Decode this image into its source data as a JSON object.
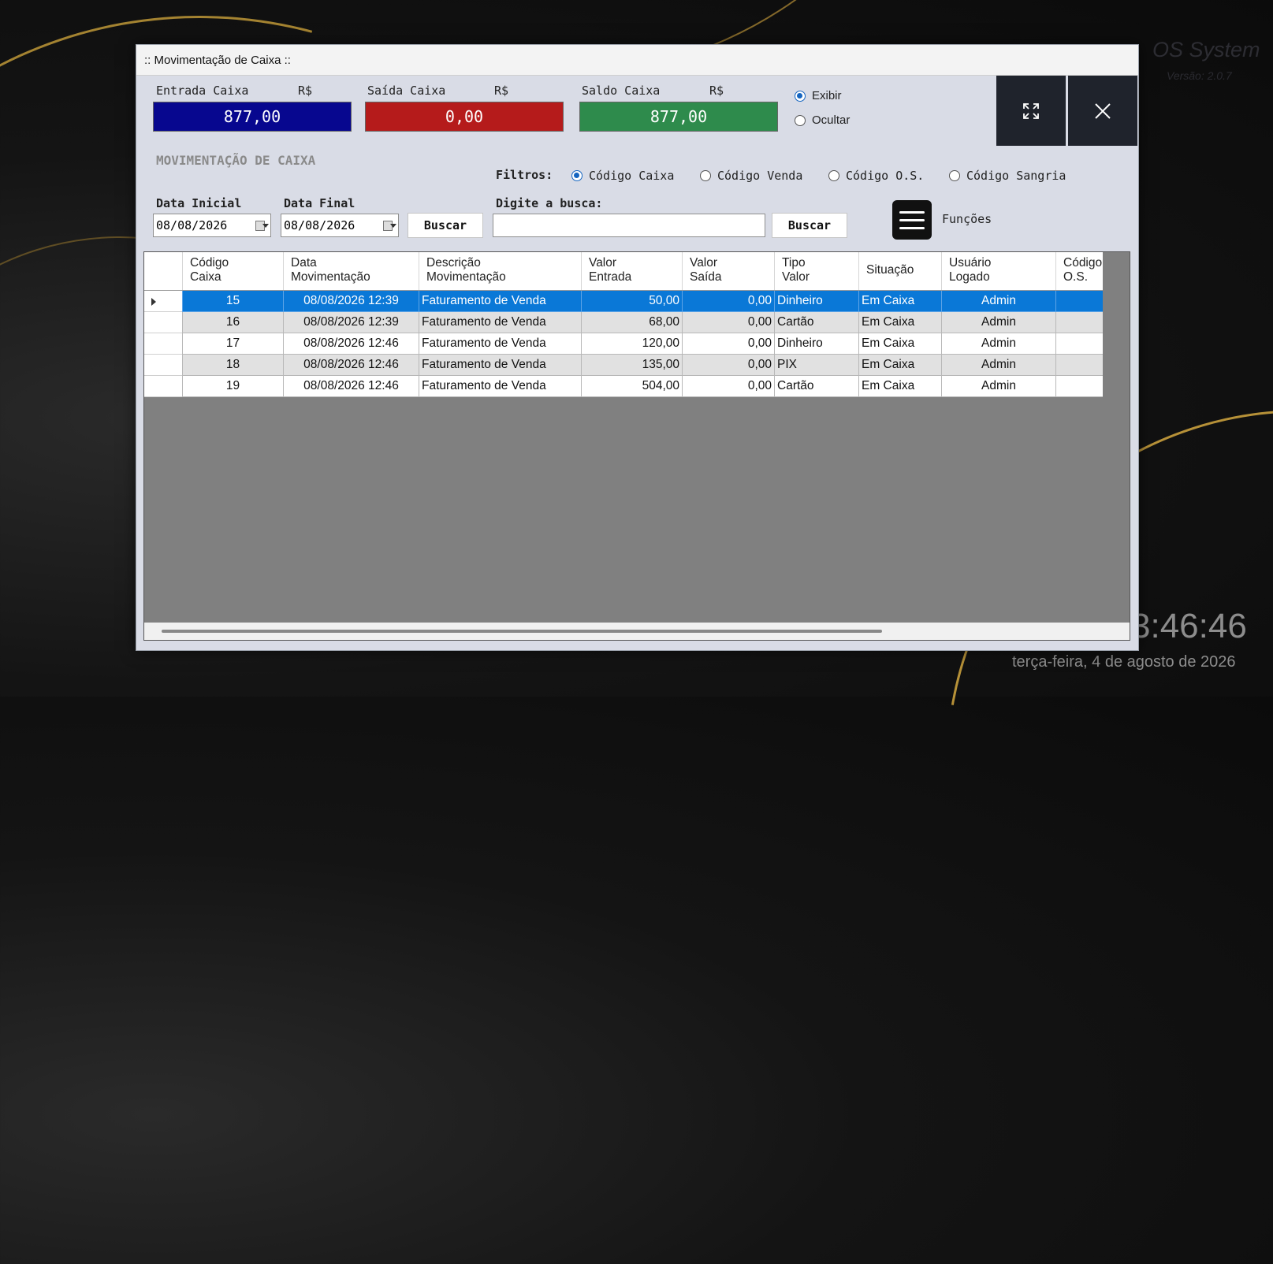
{
  "background": {
    "brand": "OS System",
    "version": "Versão: 2.0.7",
    "clock": "3:46:46",
    "date": "terça-feira, 4 de agosto de 2026"
  },
  "window": {
    "title": ":: Movimentação de Caixa ::"
  },
  "totals": {
    "entrada": {
      "label": "Entrada Caixa",
      "currency": "R$",
      "value": "877,00",
      "color": "#07078f"
    },
    "saida": {
      "label": "Saída Caixa",
      "currency": "R$",
      "value": "0,00",
      "color": "#b51b1b"
    },
    "saldo": {
      "label": "Saldo Caixa",
      "currency": "R$",
      "value": "877,00",
      "color": "#2e8b4c"
    }
  },
  "visibility": {
    "exibir": "Exibir",
    "ocultar": "Ocultar",
    "selected": "exibir"
  },
  "window_buttons": {
    "expand_icon": "expand-icon",
    "close_icon": "close-icon"
  },
  "section_title": "MOVIMENTAÇÃO DE CAIXA",
  "filters": {
    "label": "Filtros:",
    "options": [
      "Código Caixa",
      "Código Venda",
      "Código O.S.",
      "Código Sangria"
    ],
    "selected": 0
  },
  "date_filter": {
    "start_label": "Data Inicial",
    "start_value": "08/08/2026",
    "end_label": "Data Final",
    "end_value": "08/08/2026",
    "button": "Buscar"
  },
  "search": {
    "label": "Digite a busca:",
    "value": "",
    "button": "Buscar"
  },
  "functions": {
    "label": "Funções"
  },
  "grid": {
    "columns": [
      "Código\nCaixa",
      "Data\nMovimentação",
      "Descrição\nMovimentação",
      "Valor\nEntrada",
      "Valor\nSaída",
      "Tipo\nValor",
      "Situação",
      "Usuário\nLogado",
      "Código\nO.S."
    ],
    "rows": [
      {
        "codigo": "15",
        "data": "08/08/2026 12:39",
        "descricao": "Faturamento de Venda",
        "entrada": "50,00",
        "saida": "0,00",
        "tipo": "Dinheiro",
        "situacao": "Em Caixa",
        "usuario": "Admin",
        "os": ""
      },
      {
        "codigo": "16",
        "data": "08/08/2026 12:39",
        "descricao": "Faturamento de Venda",
        "entrada": "68,00",
        "saida": "0,00",
        "tipo": "Cartão",
        "situacao": "Em Caixa",
        "usuario": "Admin",
        "os": ""
      },
      {
        "codigo": "17",
        "data": "08/08/2026 12:46",
        "descricao": "Faturamento de Venda",
        "entrada": "120,00",
        "saida": "0,00",
        "tipo": "Dinheiro",
        "situacao": "Em Caixa",
        "usuario": "Admin",
        "os": ""
      },
      {
        "codigo": "18",
        "data": "08/08/2026 12:46",
        "descricao": "Faturamento de Venda",
        "entrada": "135,00",
        "saida": "0,00",
        "tipo": "PIX",
        "situacao": "Em Caixa",
        "usuario": "Admin",
        "os": ""
      },
      {
        "codigo": "19",
        "data": "08/08/2026 12:46",
        "descricao": "Faturamento de Venda",
        "entrada": "504,00",
        "saida": "0,00",
        "tipo": "Cartão",
        "situacao": "Em Caixa",
        "usuario": "Admin",
        "os": ""
      }
    ],
    "selected_row": 0
  }
}
